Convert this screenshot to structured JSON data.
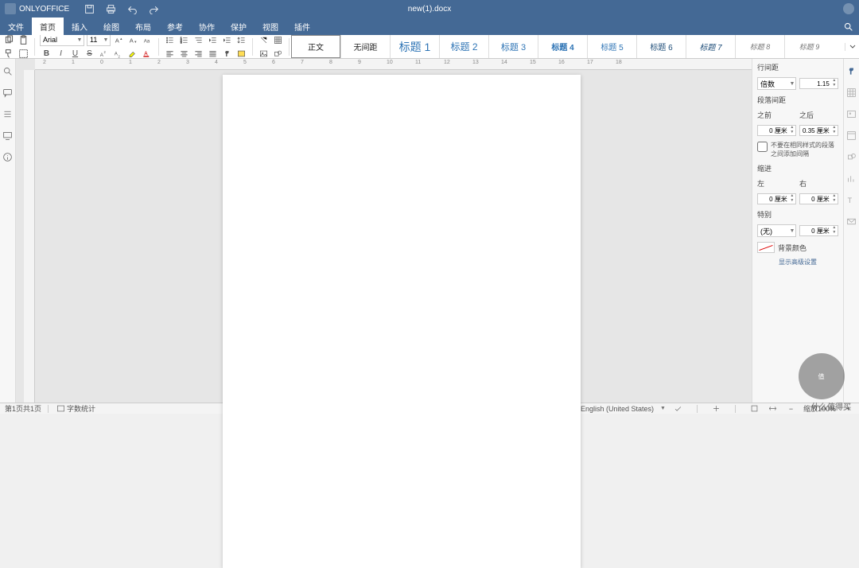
{
  "title": {
    "brand": "ONLYOFFICE",
    "doc": "new(1).docx"
  },
  "menu": [
    "文件",
    "首页",
    "插入",
    "绘图",
    "布局",
    "参考",
    "协作",
    "保护",
    "视图",
    "插件"
  ],
  "menu_active": 1,
  "toolbar": {
    "font_name": "Arial",
    "font_size": "11",
    "bold": "B",
    "italic": "I",
    "underline": "U",
    "strike": "S"
  },
  "styles": [
    {
      "cls": "sel",
      "label": "正文"
    },
    {
      "cls": "",
      "label": "无间距"
    },
    {
      "cls": "h1",
      "label": "标题 1"
    },
    {
      "cls": "h2",
      "label": "标题 2"
    },
    {
      "cls": "h3",
      "label": "标题 3"
    },
    {
      "cls": "h4",
      "label": "标题 4"
    },
    {
      "cls": "h5",
      "label": "标题 5"
    },
    {
      "cls": "h6",
      "label": "标题 6"
    },
    {
      "cls": "h7",
      "label": "标题 7"
    },
    {
      "cls": "h8",
      "label": "标题 8"
    },
    {
      "cls": "h9",
      "label": "标题 9"
    }
  ],
  "panel": {
    "line_spacing_label": "行间距",
    "line_spacing_mode": "倍数",
    "line_spacing_value": "1.15",
    "para_spacing_label": "段落间距",
    "before_label": "之前",
    "after_label": "之后",
    "before_value": "0 厘米",
    "after_value": "0.35 厘米",
    "no_space_label": "不要在相同样式的段落之间添加间隔",
    "indent_label": "缩进",
    "left_label": "左",
    "right_label": "右",
    "left_value": "0 厘米",
    "right_value": "0 厘米",
    "special_label": "特别",
    "special_mode": "(无)",
    "special_value": "0 厘米",
    "bg_label": "背景颜色",
    "advanced": "显示高级设置"
  },
  "status": {
    "page": "第1页共1页",
    "wordcount": "字数统计",
    "lang": "English (United States)",
    "zoom": "缩放100%"
  },
  "watermark": "值",
  "wm_text": "什么值得买"
}
